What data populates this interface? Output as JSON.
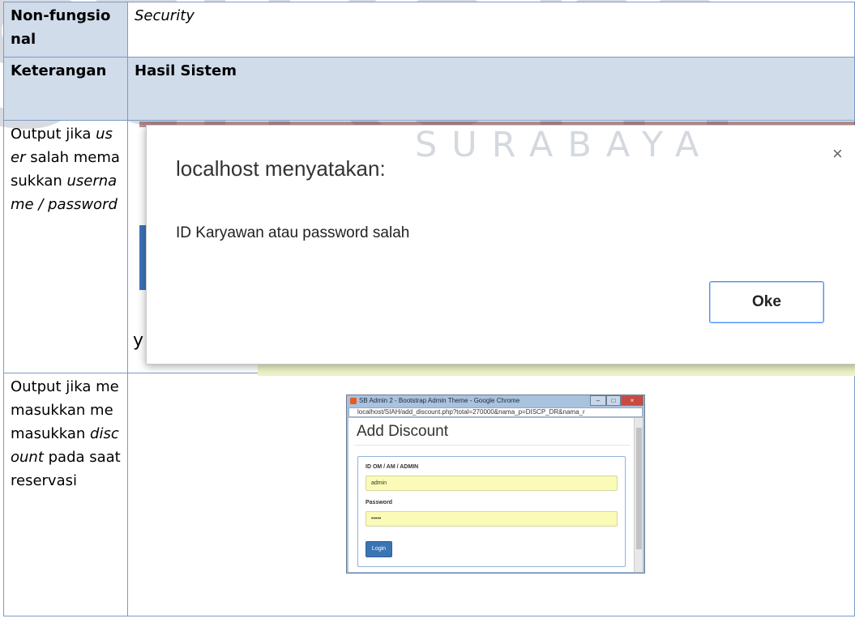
{
  "watermark": {
    "big": "stikom",
    "sub": "SURABAYA"
  },
  "table": {
    "header": {
      "label": "Non-fungsional",
      "value": "Security"
    },
    "subheader": {
      "label": "Keterangan",
      "value": "Hasil Sistem"
    },
    "rows": [
      {
        "parts": [
          {
            "text": "Output jika ",
            "italic": false
          },
          {
            "text": "user",
            "italic": true
          },
          {
            "text": " salah memasukkan ",
            "italic": false
          },
          {
            "text": "username / password",
            "italic": true
          }
        ]
      },
      {
        "parts": [
          {
            "text": "Output jika memasukkan memasukkan ",
            "italic": false
          },
          {
            "text": "discount",
            "italic": true
          },
          {
            "text": " pada saat reservasi",
            "italic": false
          }
        ]
      }
    ]
  },
  "alert_dialog": {
    "title": "localhost menyatakan:",
    "message": "ID Karyawan atau password salah",
    "ok_label": "Oke",
    "close_symbol": "×",
    "background_text": "y"
  },
  "browser_window": {
    "title": "SB Admin 2 - Bootstrap Admin Theme - Google Chrome",
    "url": "localhost/SIAH/add_discount.php?total=270000&nama_p=DISCP_DR&nama_r",
    "page_title": "Add Discount",
    "form": {
      "id_label": "ID OM / AM / ADMIN",
      "id_value": "admin",
      "password_label": "Password",
      "password_value": "•••••",
      "login_label": "Login"
    }
  },
  "colors": {
    "table_border": "#7b9bc5",
    "header_fill": "#d0dcea",
    "button_blue": "#3a74b5",
    "input_yellow": "#fbfbb8"
  }
}
